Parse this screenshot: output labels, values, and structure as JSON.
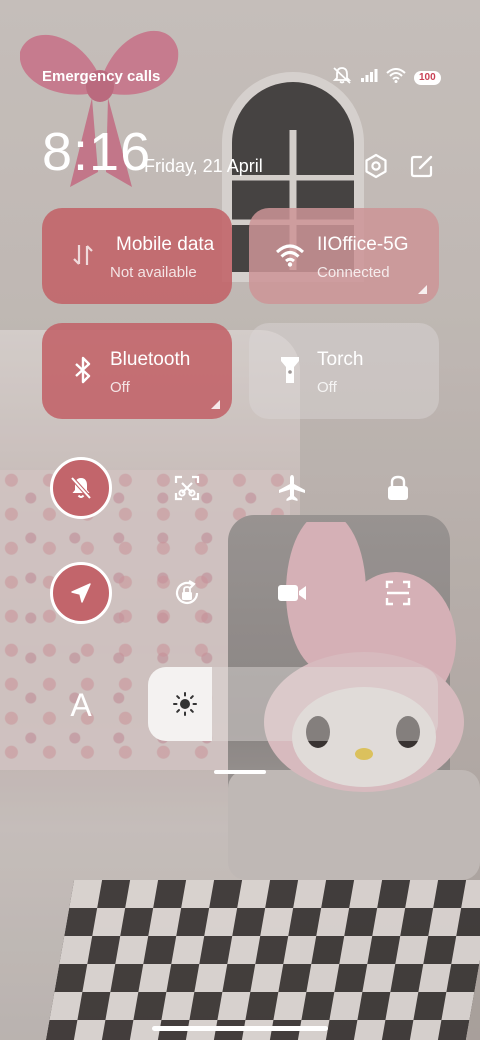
{
  "status_bar": {
    "carrier_text": "Emergency calls only",
    "battery": "100",
    "icons": [
      "mute-icon",
      "signal-icon",
      "wifi-icon",
      "battery-icon"
    ]
  },
  "header": {
    "time": "8:16",
    "date": "Friday, 21 April",
    "icons": [
      "settings-icon",
      "edit-icon"
    ]
  },
  "tiles": [
    {
      "name": "Mobile data",
      "status": "Not available",
      "icon": "mobile-data-icon",
      "state": "on"
    },
    {
      "name": "IIOffice-5G",
      "status": "Connected",
      "icon": "wifi-icon",
      "state": "on"
    },
    {
      "name": "Bluetooth",
      "status": "Off",
      "icon": "bluetooth-icon",
      "state": "on"
    },
    {
      "name": "Torch",
      "status": "Off",
      "icon": "torch-icon",
      "state": "off"
    }
  ],
  "toggles_row1": [
    {
      "icon": "silent-icon",
      "active": true
    },
    {
      "icon": "screenshot-icon",
      "active": false
    },
    {
      "icon": "airplane-icon",
      "active": false
    },
    {
      "icon": "lock-icon",
      "active": false
    }
  ],
  "toggles_row2": [
    {
      "icon": "location-icon",
      "active": true
    },
    {
      "icon": "auto-rotate-icon",
      "active": false
    },
    {
      "icon": "video-icon",
      "active": false
    },
    {
      "icon": "scanner-icon",
      "active": false
    }
  ],
  "brightness": {
    "font_label": "A",
    "level_fraction": 0.22,
    "icon": "sun-icon"
  },
  "colors": {
    "accent_on": "#c2656b",
    "tile_wifi": "#cc9496",
    "battery_text": "#c94155"
  }
}
